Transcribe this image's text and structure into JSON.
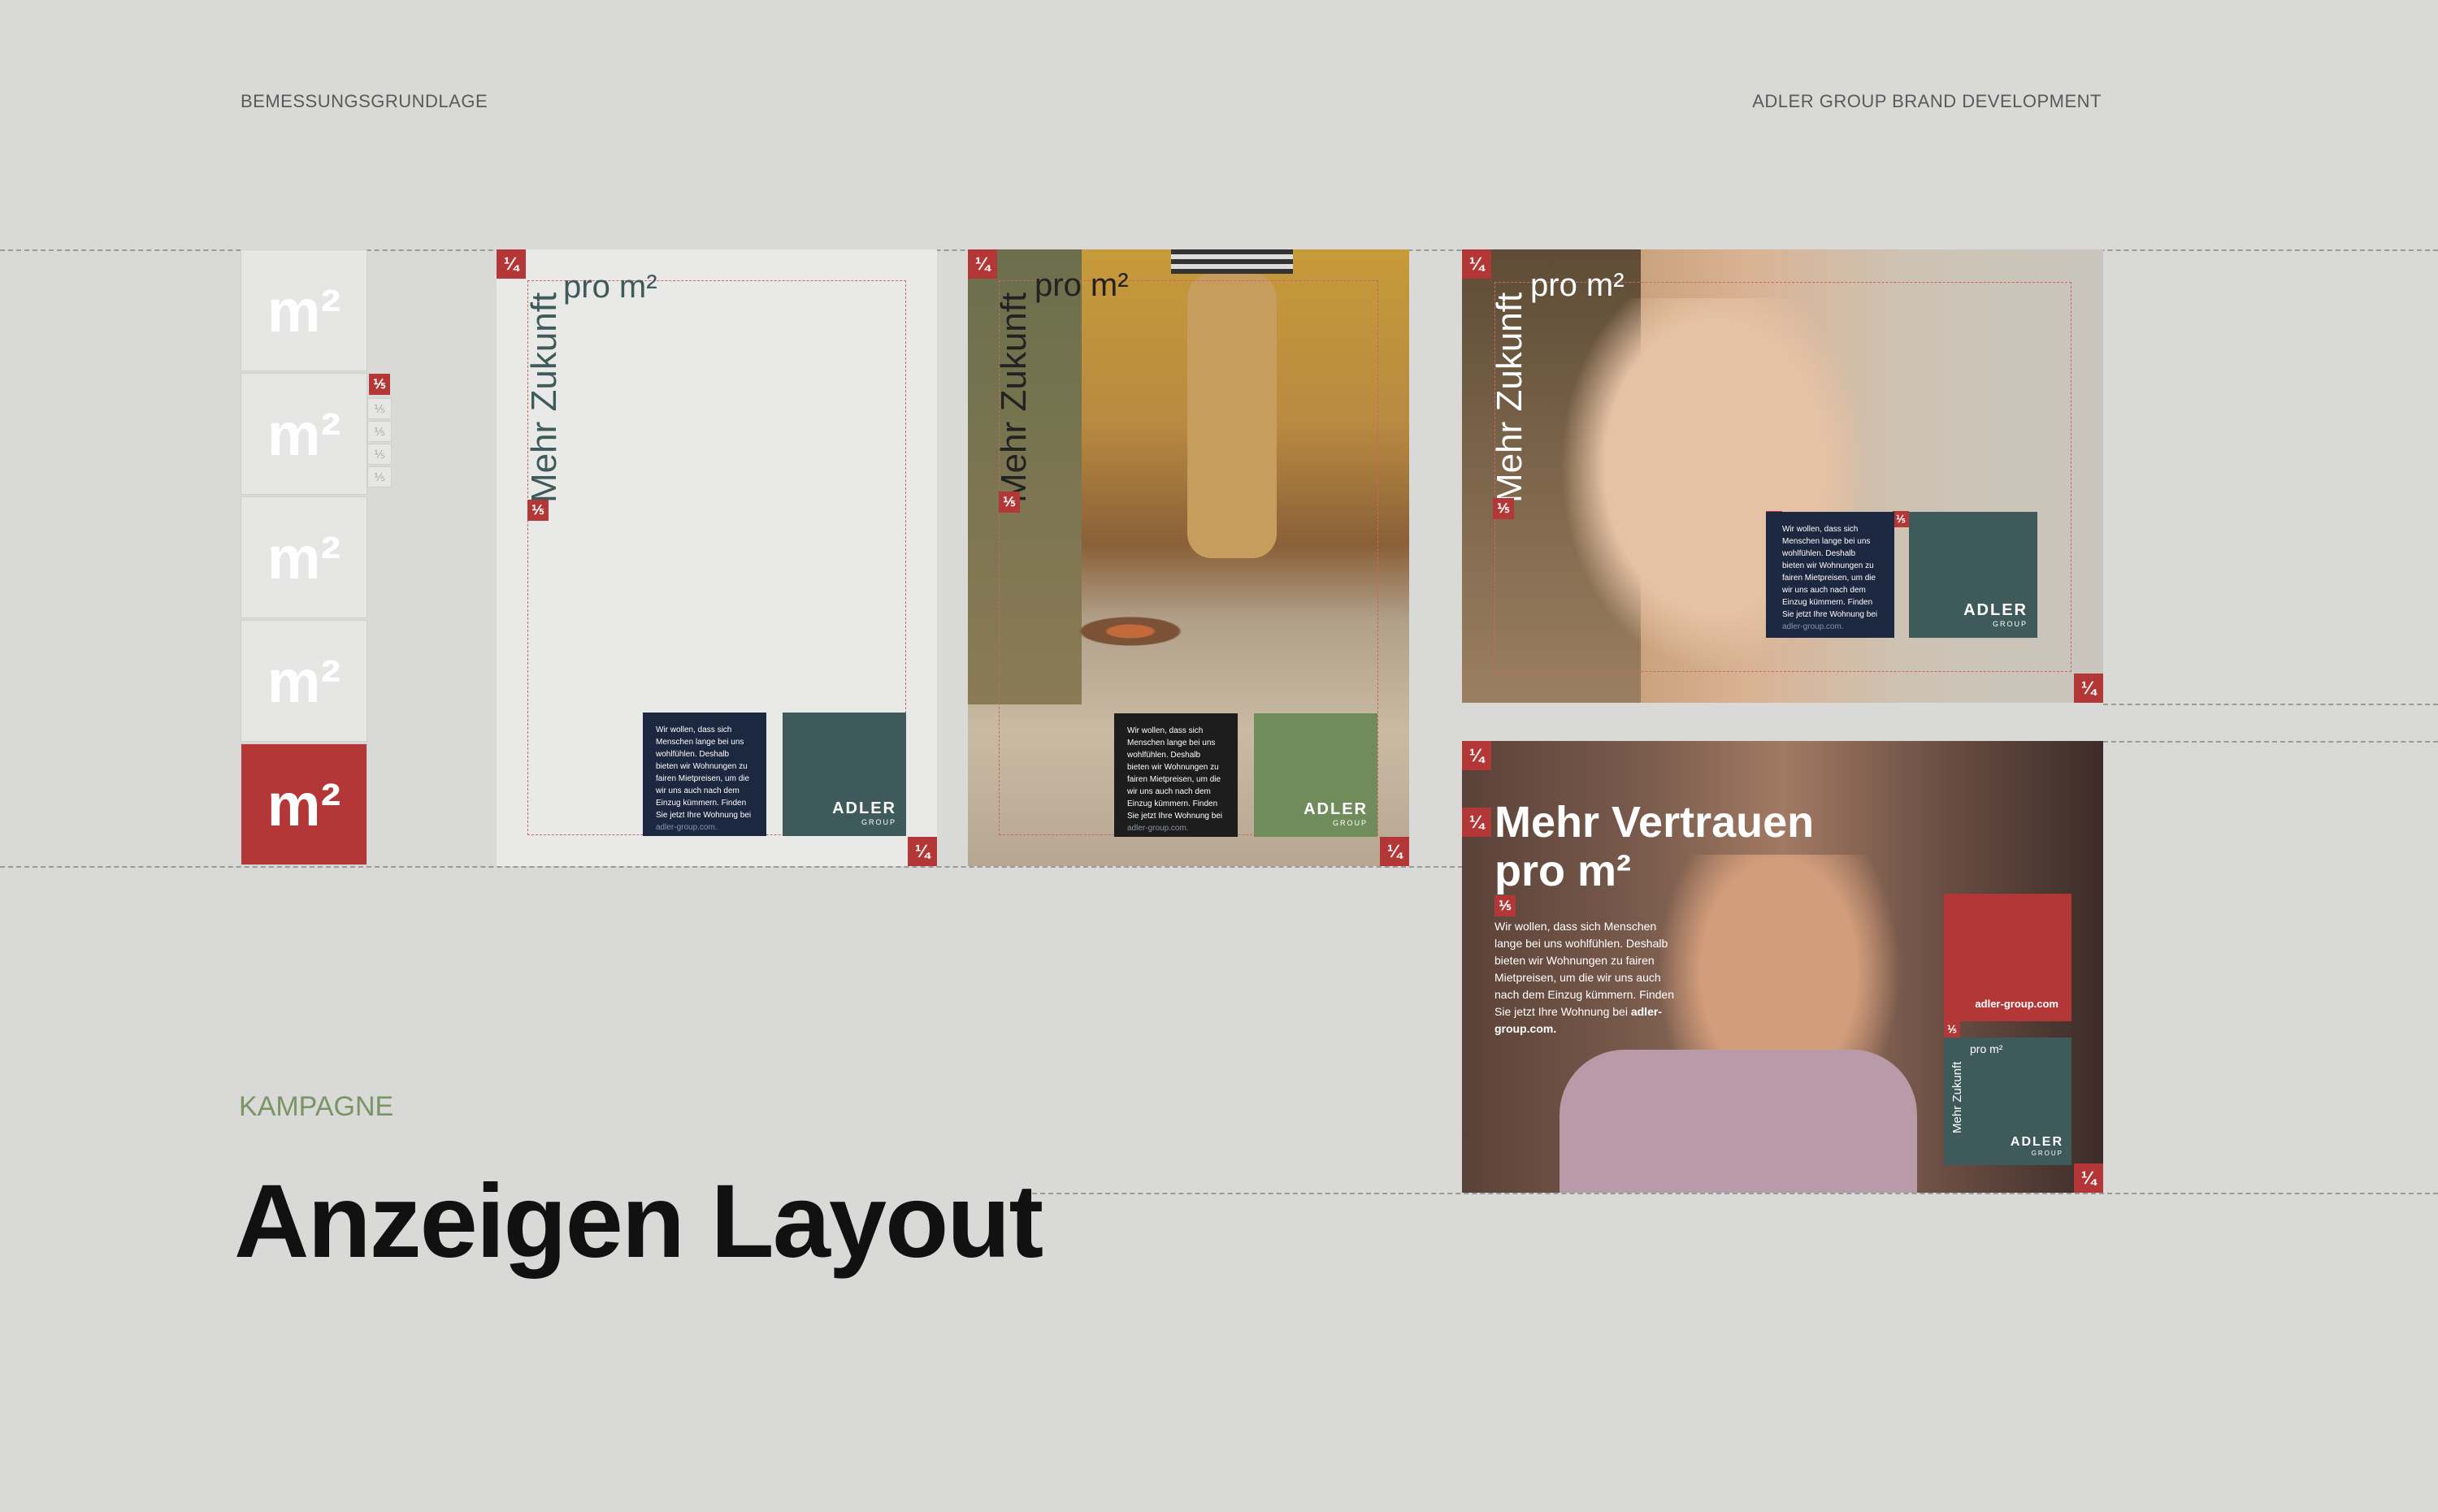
{
  "header": {
    "left": "BEMESSUNGSGRUNDLAGE",
    "right": "ADLER GROUP BRAND DEVELOPMENT"
  },
  "scale": {
    "unit": "m²",
    "cells": [
      "m²",
      "m²",
      "m²",
      "m²",
      "m²"
    ],
    "fractions": [
      "⅕",
      "⅕",
      "⅕",
      "⅕",
      "⅕"
    ]
  },
  "tags": {
    "quarter": "¼",
    "fifth": "⅕"
  },
  "ads": {
    "headline_vertical": "Mehr Zukunft",
    "headline_pro": "pro m²",
    "body_copy": "Wir wollen, dass sich Menschen lange bei uns wohlfühlen. Deshalb bieten wir Wohnungen zu fairen Mietpreisen, um die wir uns auch nach dem Einzug kümmern. Finden Sie jetzt Ihre Wohnung bei",
    "url": "adler-group.com.",
    "logo": "ADLER",
    "logo_sub": "GROUP",
    "trust_headline_line1": "Mehr Vertrauen",
    "trust_headline_line2": "pro m²",
    "trust_url_box": "adler-group.com"
  },
  "section": {
    "label": "KAMPAGNE",
    "title": "Anzeigen Layout"
  },
  "colors": {
    "red": "#b43737",
    "navy": "#1c2740",
    "teal": "#3f5a5a",
    "green": "#6f8c5a",
    "label_green": "#7a9464"
  }
}
